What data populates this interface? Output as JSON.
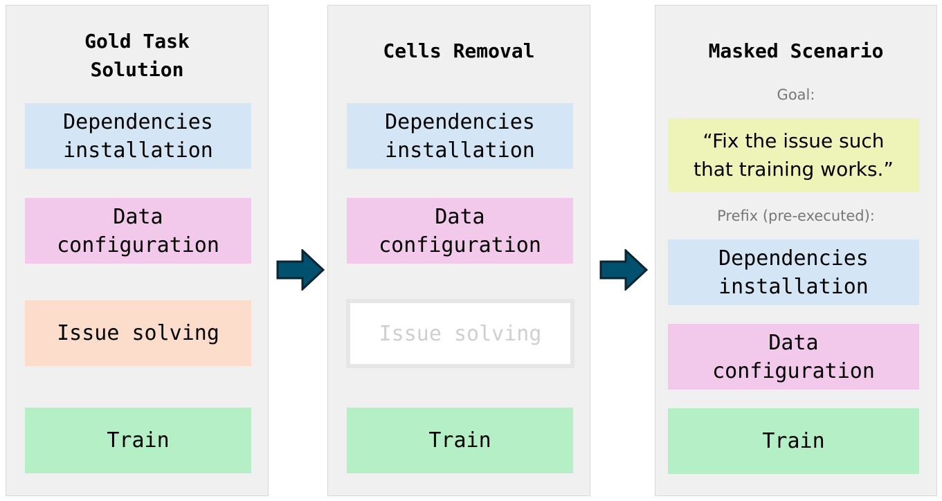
{
  "columns": [
    {
      "title": "Gold Task\nSolution",
      "boxes": [
        "Dependencies\ninstallation",
        "Data\nconfiguration",
        "Issue solving",
        "Train"
      ]
    },
    {
      "title": "Cells Removal",
      "boxes": [
        "Dependencies\ninstallation",
        "Data\nconfiguration",
        "Issue solving",
        "Train"
      ]
    },
    {
      "title": "Masked Scenario",
      "goal_label": "Goal:",
      "goal_text": "“Fix the issue such\nthat training works.”",
      "prefix_label": "Prefix (pre-executed):",
      "boxes": [
        "Dependencies\ninstallation",
        "Data\nconfiguration",
        "Train"
      ]
    }
  ],
  "colors": {
    "dependencies": "#d4e6f5",
    "data": "#f2c9ea",
    "issue": "#fcdccb",
    "train": "#b4efc6",
    "goal": "#eef3b8",
    "arrow": "#00506e"
  },
  "icons": [
    "arrow-right-icon",
    "arrow-right-icon"
  ]
}
